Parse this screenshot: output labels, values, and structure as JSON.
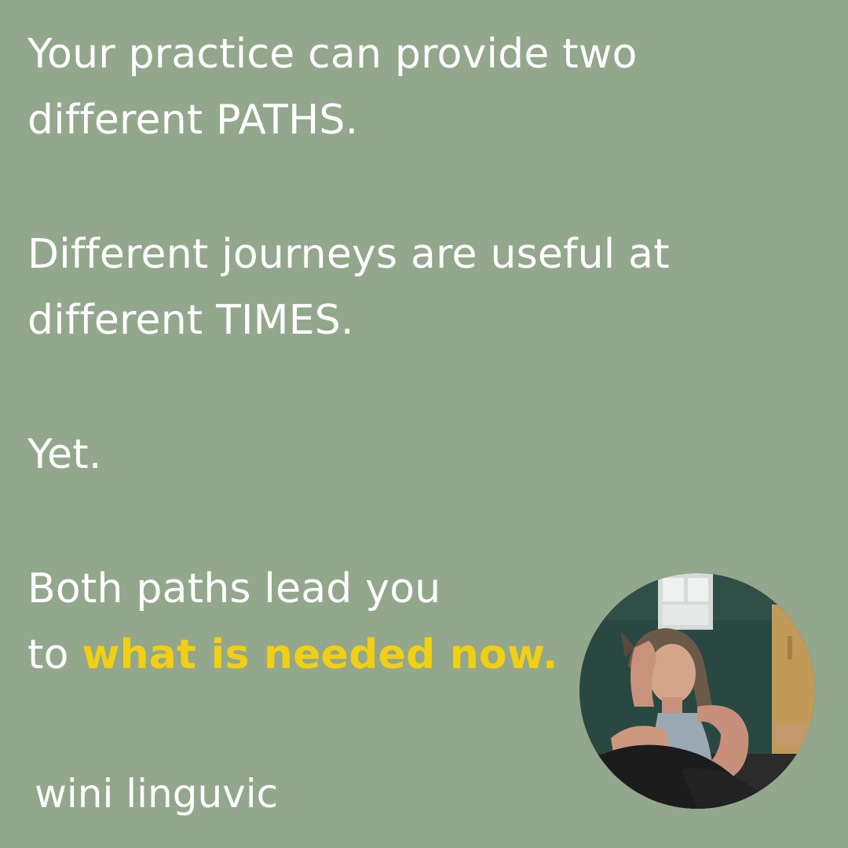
{
  "colors": {
    "background": "#93a78c",
    "text": "#ffffff",
    "accent": "#f1cf12"
  },
  "quote": {
    "line1": "Your practice can provide two",
    "line2": "different PATHS.",
    "line3": "Different journeys are useful at",
    "line4": "different TIMES.",
    "line5": "Yet.",
    "line6": "Both paths lead you",
    "line7_prefix": "to ",
    "line7_highlight": "what is needed now."
  },
  "signature": "wini linguvic",
  "portrait": {
    "icon": "portrait-photo"
  }
}
